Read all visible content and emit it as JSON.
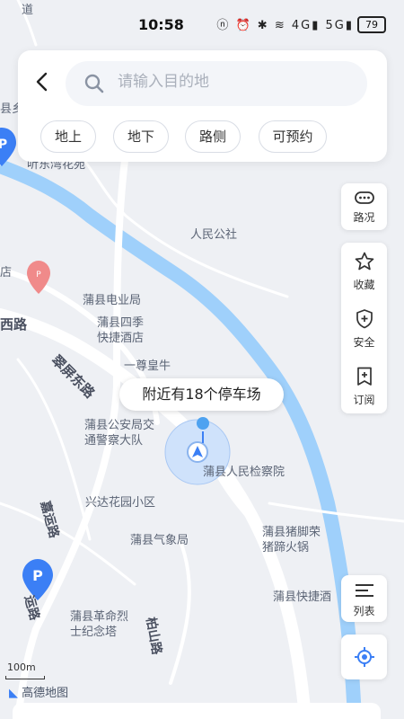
{
  "status": {
    "time": "10:58",
    "icons_text": "ⓝ ⏰ ✱ ≋ 4G▮ 5G▮",
    "battery": "79"
  },
  "search": {
    "back_icon": "back-arrow-icon",
    "placeholder": "请输入目的地"
  },
  "filters": [
    "地上",
    "地下",
    "路侧",
    "可预约"
  ],
  "side_panel_1": [
    {
      "label": "路况",
      "icon": "traffic-icon"
    }
  ],
  "side_panel_2": [
    {
      "label": "收藏",
      "icon": "star-icon"
    },
    {
      "label": "安全",
      "icon": "shield-icon"
    },
    {
      "label": "订阅",
      "icon": "subscribe-icon"
    }
  ],
  "side_panel_3": [
    {
      "label": "列表",
      "icon": "list-icon"
    }
  ],
  "nearby": "附近有18个停车场",
  "scale": "100m",
  "logo": "高德地图",
  "map_labels": [
    "人民公社",
    "蒲县电业局",
    "蒲县四季\n快捷酒店",
    "一尊皇牛",
    "蒲县公安局交\n通警察大队",
    "蒲县人民检察院",
    "兴达花园小区",
    "蒲县气象局",
    "蒲县猪脚荣\n猪蹄火锅",
    "蒲县快捷酒",
    "蒲县革命烈\n士纪念塔",
    "西路",
    "翠屏东路",
    "嘉运路",
    "运路",
    "柏山路",
    "店",
    "县乡",
    "道",
    "听东湾花苑"
  ],
  "colors": {
    "river": "#9fd0fb",
    "road": "#ffffff",
    "parking": "#3b7ff5",
    "poi": "#f26b6b",
    "accent": "#3b7ff5"
  }
}
